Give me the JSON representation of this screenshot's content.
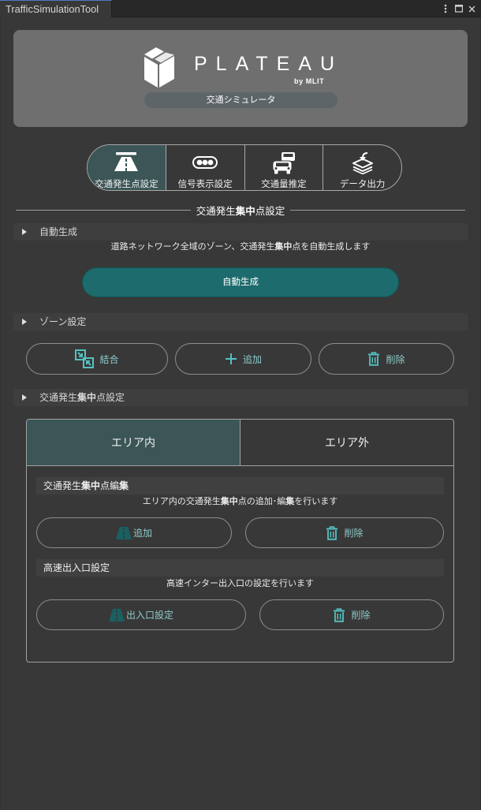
{
  "theme": {
    "accent": "#1d6b6c",
    "selected_tab_bg": "#3c5557",
    "icon_color": "#55c1c1",
    "road_icon_color": "#1b6061"
  },
  "window": {
    "tab_title": "TrafficSimulationTool",
    "controls": [
      "kebab-menu-icon",
      "maximize-icon",
      "close-icon"
    ]
  },
  "header": {
    "logo_icon": "plateau-logo-icon",
    "logo_text": "PLATEAU",
    "logo_byline": "by MLIT",
    "subtitle": "交通シミュレータ"
  },
  "mode_tabs": [
    {
      "label": "交通発生点設定",
      "icon": "highway-icon",
      "selected": true
    },
    {
      "label": "信号表示設定",
      "icon": "traffic-light-icon",
      "selected": false
    },
    {
      "label": "交通量推定",
      "icon": "traffic-cars-icon",
      "selected": false
    },
    {
      "label": "データ出力",
      "icon": "data-export-icon",
      "selected": false
    }
  ],
  "section_title": [
    "交通発生",
    "集中",
    "点設定"
  ],
  "auto_generate": {
    "foldout_label": "自動生成",
    "description": [
      "道路ネットワーク全域のゾーン、交通発生",
      "集中",
      "点を自動生成します"
    ],
    "button_label": "自動生成"
  },
  "zone_settings": {
    "foldout_label": "ゾーン設定",
    "buttons": [
      {
        "label": "結合",
        "icon": "merge-icon"
      },
      {
        "label": "追加",
        "icon": "plus-icon"
      },
      {
        "label": "削除",
        "icon": "trash-icon"
      }
    ]
  },
  "point_settings": {
    "foldout_label": [
      "交通発生",
      "集中",
      "点設定"
    ],
    "tabs": [
      {
        "label": "エリア内",
        "selected": true
      },
      {
        "label": "エリア外",
        "selected": false
      }
    ],
    "edit_section": {
      "title": [
        "交通発生",
        "集中",
        "点編",
        "集"
      ],
      "description": [
        "エリア内の交通発生",
        "集中",
        "点の追加･編",
        "集",
        "を行います"
      ],
      "buttons": [
        {
          "label": "追加",
          "icon": "road-icon"
        },
        {
          "label": "削除",
          "icon": "trash-icon"
        }
      ]
    },
    "highway_section": {
      "title": "高速出入口設定",
      "description": "高速インター出入口の設定を行います",
      "buttons": [
        {
          "label": "出入口設定",
          "icon": "road-icon"
        },
        {
          "label": "削除",
          "icon": "trash-icon"
        }
      ]
    }
  }
}
